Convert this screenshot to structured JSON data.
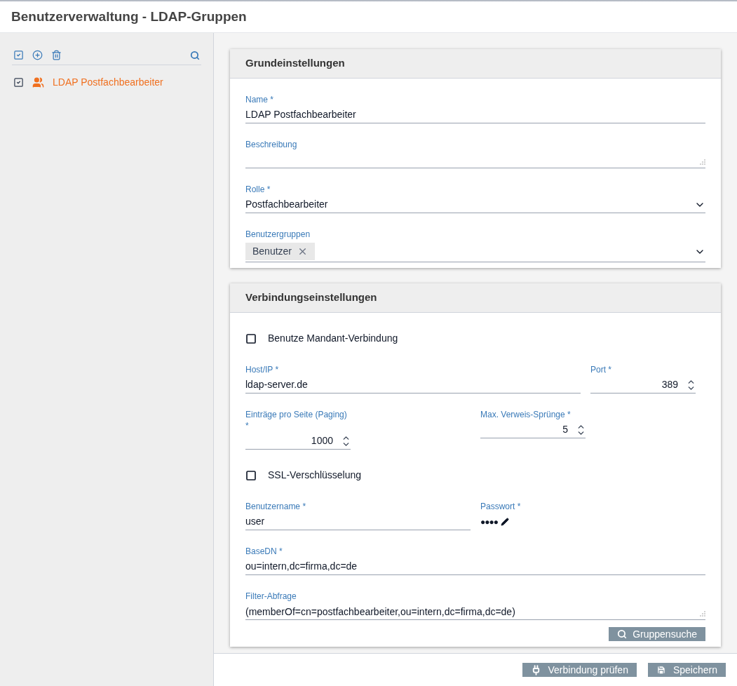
{
  "header": {
    "title": "Benutzerverwaltung - LDAP-Gruppen"
  },
  "sidebar": {
    "items": [
      {
        "label": "LDAP Postfachbearbeiter",
        "checked": true,
        "selected": true
      }
    ]
  },
  "sections": [
    {
      "title": "Grundeinstellungen",
      "fields": [
        {
          "kind": "text",
          "label": "Name *",
          "value": "LDAP Postfachbearbeiter"
        },
        {
          "kind": "textarea",
          "label": "Beschreibung"
        },
        {
          "kind": "select",
          "label": "Rolle *",
          "value": "Postfachbearbeiter"
        },
        {
          "kind": "chips",
          "label": "Benutzergruppen",
          "chips": [
            "Benutzer"
          ]
        }
      ]
    },
    {
      "title": "Verbindungseinstellungen",
      "fields": [
        {
          "kind": "checkbox",
          "label": "Benutze Mandant-Verbindung",
          "checked": false
        },
        {
          "kind": "row",
          "items": [
            {
              "kind": "text",
              "label": "Host/IP *",
              "value": "ldap-server.de"
            },
            {
              "kind": "number",
              "label": "Port *",
              "value": "389"
            }
          ]
        },
        {
          "kind": "row",
          "items": [
            {
              "kind": "number",
              "label": "Einträge pro Seite (Paging) *",
              "value": "1000"
            },
            {
              "kind": "number",
              "label": "Max. Verweis-Sprünge *",
              "value": "5"
            }
          ]
        },
        {
          "kind": "checkbox",
          "label": "SSL-Verschlüsselung",
          "checked": false
        },
        {
          "kind": "row",
          "items": [
            {
              "kind": "text",
              "label": "Benutzername *",
              "value": "user"
            },
            {
              "kind": "password",
              "label": "Passwort *",
              "value": "●●●●"
            }
          ]
        },
        {
          "kind": "text",
          "label": "BaseDN *",
          "value": "ou=intern,dc=firma,dc=de"
        },
        {
          "kind": "textarea",
          "label": "Filter-Abfrage",
          "value": "(memberOf=cn=postfachbearbeiter,ou=intern,dc=firma,dc=de)"
        }
      ],
      "button": "Gruppensuche"
    }
  ],
  "footer": {
    "buttons": [
      {
        "kind": "test",
        "label": "Verbindung prüfen"
      },
      {
        "kind": "save",
        "label": "Speichern"
      }
    ]
  }
}
